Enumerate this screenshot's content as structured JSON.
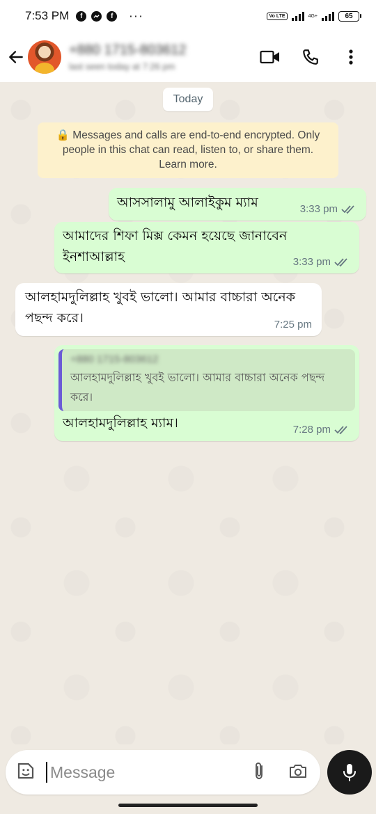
{
  "status_bar": {
    "time": "7:53 PM",
    "app_icons": [
      "facebook-icon",
      "messenger-icon",
      "facebook-icon"
    ],
    "overflow": "···",
    "volte_label": "Vo LTE",
    "network_label": "4G+",
    "battery": "65"
  },
  "header": {
    "contact_name": "+880 1715-803612",
    "last_seen": "last seen today at 7:26 pm",
    "icons": [
      "back-arrow-icon",
      "video-call-icon",
      "voice-call-icon",
      "more-vertical-icon"
    ]
  },
  "chat": {
    "date_chip": "Today",
    "encryption_notice": "🔒 Messages and calls are end-to-end encrypted. Only people in this chat can read, listen to, or share them. Learn more.",
    "messages": [
      {
        "direction": "out",
        "text": "আসসালামু আলাইকুম ম্যাম",
        "time": "3:33 pm",
        "status": "read"
      },
      {
        "direction": "out",
        "text": "আমাদের শিফা মিক্স কেমন হয়েছে জানাবেন ইনশাআল্লাহ",
        "time": "3:33 pm",
        "status": "read"
      },
      {
        "direction": "in",
        "text": "আলহামদুলিল্লাহ খুবই ভালো। আমার বাচ্চারা অনেক পছন্দ করে।",
        "time": "7:25 pm"
      },
      {
        "direction": "out",
        "quote": {
          "author": "+880 1715-803612",
          "text": "আলহামদুলিল্লাহ খুবই ভালো। আমার বাচ্চারা অনেক পছন্দ করে।"
        },
        "text": "আলহামদুলিল্লাহ ম্যাম।",
        "time": "7:28 pm",
        "status": "read"
      }
    ]
  },
  "composer": {
    "placeholder": "Message",
    "icons": [
      "emoji-sticker-icon",
      "attach-icon",
      "camera-icon",
      "mic-icon"
    ]
  },
  "colors": {
    "outgoing_bubble": "#d9fdd3",
    "incoming_bubble": "#ffffff",
    "chat_background": "#efeae2",
    "quote_bar": "#6b5bd6",
    "tick_read": "#667781"
  }
}
